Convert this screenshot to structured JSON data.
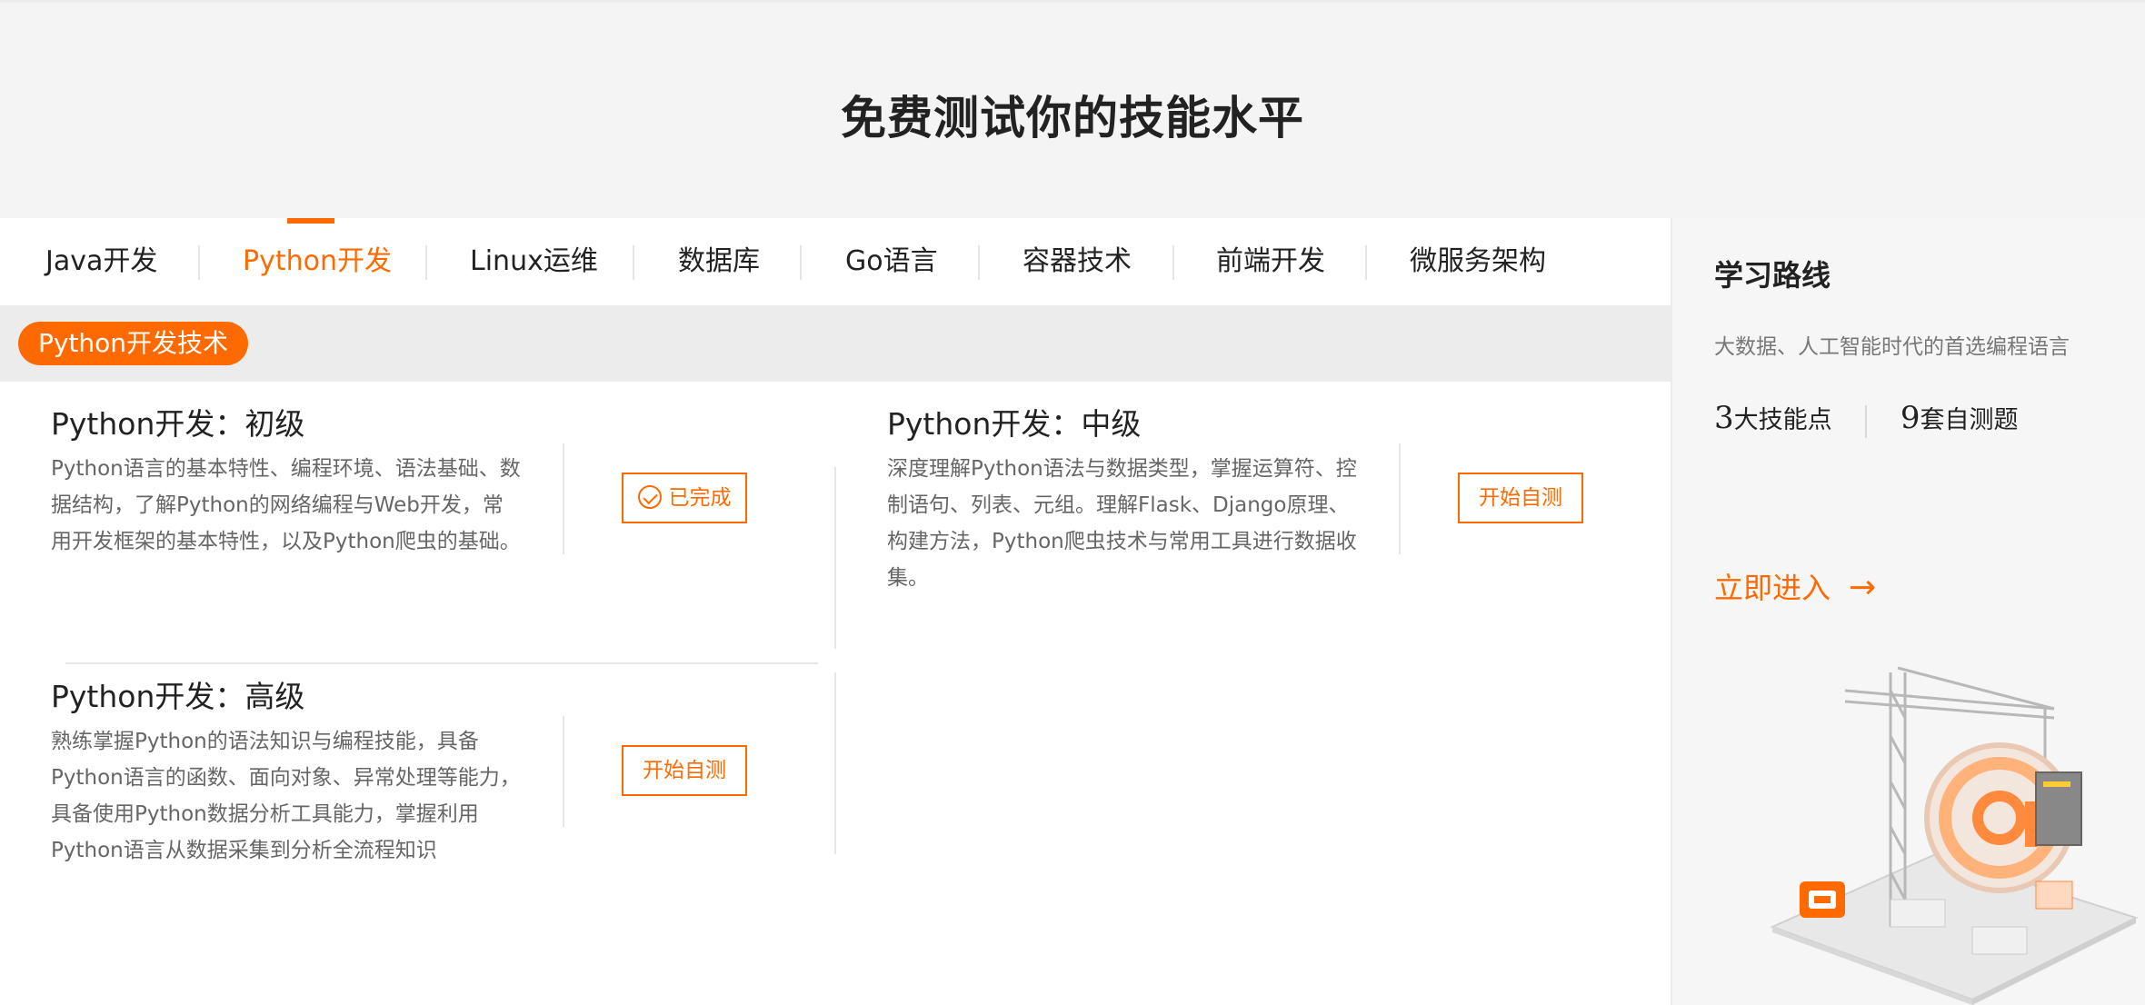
{
  "hero": {
    "title": "免费测试你的技能水平"
  },
  "tabs": [
    {
      "label": "Java开发"
    },
    {
      "label": "Python开发",
      "active": true
    },
    {
      "label": "Linux运维"
    },
    {
      "label": "数据库"
    },
    {
      "label": "Go语言"
    },
    {
      "label": "容器技术"
    },
    {
      "label": "前端开发"
    },
    {
      "label": "微服务架构"
    }
  ],
  "category_pill": "Python开发技术",
  "cards": [
    {
      "title": "Python开发：初级",
      "desc": "Python语言的基本特性、编程环境、语法基础、数据结构，了解Python的网络编程与Web开发，常用开发框架的基本特性，以及Python爬虫的基础。",
      "button": "已完成",
      "completed": true
    },
    {
      "title": "Python开发：中级",
      "desc": "深度理解Python语法与数据类型，掌握运算符、控制语句、列表、元组。理解Flask、Django原理、构建方法，Python爬虫技术与常用工具进行数据收集。",
      "button": "开始自测",
      "completed": false
    },
    {
      "title": "Python开发：高级",
      "desc": "熟练掌握Python的语法知识与编程技能，具备Python语言的函数、面向对象、异常处理等能力，具备使用Python数据分析工具能力，掌握利用Python语言从数据采集到分析全流程知识",
      "button": "开始自测",
      "completed": false
    }
  ],
  "sidebar": {
    "title": "学习路线",
    "subtitle": "大数据、人工智能时代的首选编程语言",
    "stat1_num": "3",
    "stat1_label": "大技能点",
    "stat2_num": "9",
    "stat2_label": "套自测题",
    "enter_label": "立即进入",
    "enter_icon": "arrow-right-icon"
  },
  "colors": {
    "accent": "#ff6a00",
    "hero_bg": "#f4f4f4",
    "subbar_bg": "#ececec"
  }
}
